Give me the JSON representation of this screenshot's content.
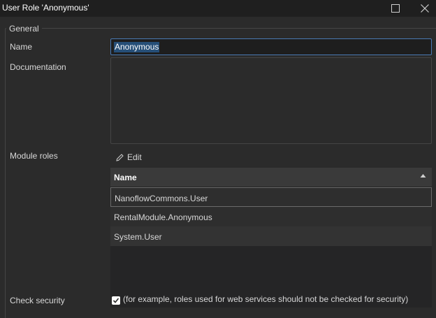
{
  "window": {
    "title": "User Role 'Anonymous'"
  },
  "general": {
    "legend": "General",
    "name_label": "Name",
    "name_value": "Anonymous",
    "documentation_label": "Documentation",
    "documentation_value": ""
  },
  "module_roles": {
    "label": "Module roles",
    "edit_label": "Edit",
    "column_header": "Name",
    "rows": [
      "NanoflowCommons.User",
      "RentalModule.Anonymous",
      "System.User"
    ]
  },
  "check_security": {
    "label": "Check security",
    "checked": true,
    "note": "(for example, roles used for web services should not be checked for security)"
  },
  "icons": {
    "maximize": "maximize-icon",
    "close": "close-icon",
    "edit": "pencil-icon",
    "sort": "sort-ascending-icon",
    "checkbox": "check-icon"
  }
}
